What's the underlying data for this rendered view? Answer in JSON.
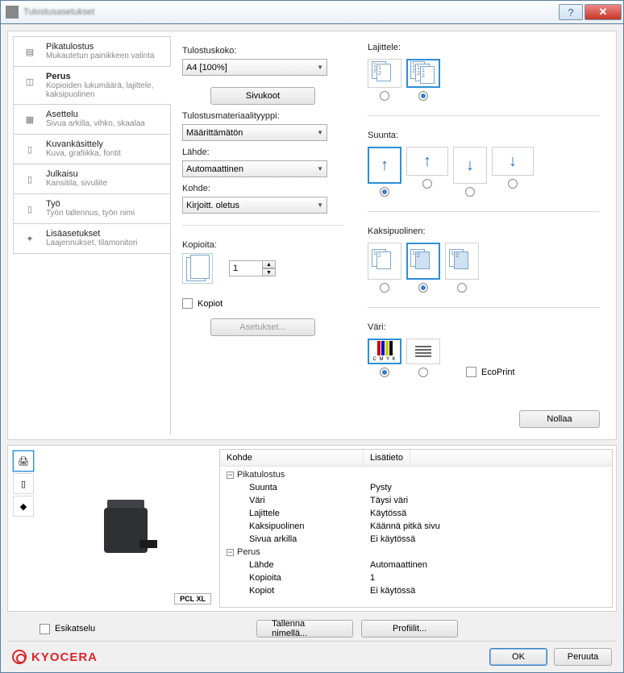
{
  "window": {
    "title": "Tulostusasetukset"
  },
  "sidebar": [
    {
      "title": "Pikatulostus",
      "sub": "Mukautetun painikkeen valinta"
    },
    {
      "title": "Perus",
      "sub": "Kopioiden lukumäärä, lajittele, kaksipuolinen"
    },
    {
      "title": "Asettelu",
      "sub": "Sivua arkilla, vihko, skaalaa"
    },
    {
      "title": "Kuvankäsittely",
      "sub": "Kuva, grafiikka, fontit"
    },
    {
      "title": "Julkaisu",
      "sub": "Kansitila, sivuliite"
    },
    {
      "title": "Työ",
      "sub": "Työn tallennus, työn nimi"
    },
    {
      "title": "Lisäasetukset",
      "sub": "Laajennukset, tilamonitori"
    }
  ],
  "left": {
    "size_label": "Tulostuskoko:",
    "size_value": "A4  [100%]",
    "pagesizes_btn": "Sivukoot",
    "media_label": "Tulostusmateriaalityyppi:",
    "media_value": "Määrittämätön",
    "source_label": "Lähde:",
    "source_value": "Automaattinen",
    "dest_label": "Kohde:",
    "dest_value": "Kirjoitt. oletus",
    "copies_label": "Kopioita:",
    "copies_value": "1",
    "collate_label": "Kopiot",
    "settings_btn": "Asetukset..."
  },
  "right": {
    "collate_label": "Lajittele:",
    "orient_label": "Suunta:",
    "duplex_label": "Kaksipuolinen:",
    "color_label": "Väri:",
    "cmyk_label": "C M Y K",
    "ecoprint_label": "EcoPrint",
    "reset_btn": "Nollaa"
  },
  "preview": {
    "pcl_badge": "PCL XL",
    "col_kohde": "Kohde",
    "col_lisatieto": "Lisätieto",
    "rows": [
      {
        "grp": true,
        "k": "Pikatulostus",
        "v": ""
      },
      {
        "sub": true,
        "k": "Suunta",
        "v": "Pysty"
      },
      {
        "sub": true,
        "k": "Väri",
        "v": "Täysi väri"
      },
      {
        "sub": true,
        "k": "Lajittele",
        "v": "Käytössä"
      },
      {
        "sub": true,
        "k": "Kaksipuolinen",
        "v": "Käännä pitkä sivu"
      },
      {
        "sub": true,
        "k": "Sivua arkilla",
        "v": "Ei käytössä"
      },
      {
        "grp": true,
        "k": "Perus",
        "v": ""
      },
      {
        "sub": true,
        "k": "Lähde",
        "v": "Automaattinen"
      },
      {
        "sub": true,
        "k": "Kopioita",
        "v": "1"
      },
      {
        "sub": true,
        "k": "Kopiot",
        "v": "Ei käytössä"
      }
    ]
  },
  "bottom": {
    "preview_check": "Esikatselu",
    "saveas_btn": "Tallenna nimellä...",
    "profiles_btn": "Profiilit..."
  },
  "brand": "KYOCERA",
  "footer": {
    "ok": "OK",
    "cancel": "Peruuta"
  }
}
